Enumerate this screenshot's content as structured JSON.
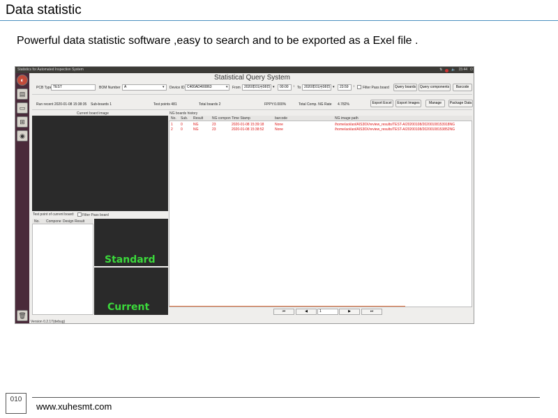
{
  "slide": {
    "title": "Data statistic",
    "subtitle": "Powerful data statistic software ,easy to search and to be exported as a Exel file .",
    "page_number": "010",
    "website": "www.xuhesmt.com"
  },
  "window": {
    "title": "Statistics for Automated Inspection System",
    "tray_time": "15:44",
    "app_title": "Statistical Query System"
  },
  "query": {
    "pcb_type_label": "PCB Type",
    "pcb_type_value": "TEST",
    "bom_number_label": "BOM Number",
    "bom_number_value": "A",
    "device_id_label": "Device ID",
    "device_id_value": "C400AD400863",
    "from_label": "From",
    "from_date": "2020年01月08日",
    "from_time": "00:00",
    "to_label": "To",
    "to_date": "2020年01月08日",
    "to_time": "23:59",
    "filter_pass_label": "Filter Pass board",
    "query_boards_label": "Query boards",
    "query_components_label": "Query components",
    "barcode_label": "Barcode"
  },
  "summary": {
    "run_recent": "Run recent 2020-01-08 15:38:35",
    "sub_boards": "Sub-boards 1",
    "test_points": "Test points 481",
    "total_boards": "Total boards 2",
    "fppy": "FPPY:0.000%",
    "total_comp_ng": "Total Comp. NG Rate",
    "ng_rate": "4.782%",
    "export_excel": "Export Excel",
    "export_images": "Export Images",
    "manage": "Manage",
    "package_data": "Package Data"
  },
  "left_panel": {
    "current_board_image": "Current board image",
    "test_point_label": "Test point of current board:",
    "filter_pass_board": "Filter Pass board",
    "columns": [
      "No.",
      "Compone",
      "Design",
      "Result"
    ],
    "standard_label": "Standard",
    "current_label": "Current"
  },
  "history": {
    "label": "NG boards history",
    "columns": [
      "No.",
      "Sub.",
      "Result",
      "NG compon",
      "Time Stamp",
      "barcode",
      "NG image path"
    ],
    "rows": [
      [
        "1",
        "0",
        "NG",
        "23",
        "2020-01-08 15:39:18",
        "None",
        "/home/aoi/aoi/AIS30X/review_results/TEST-A/20200108/20200108153918NG"
      ],
      [
        "2",
        "0",
        "NG",
        "23",
        "2020-01-08 15:38:52",
        "None",
        "/home/aoi/aoi/AIS30X/review_results/TEST-A/20200108/20200108153852NG"
      ]
    ],
    "page_value": "1"
  },
  "status_bar": {
    "version": "Version 0.2.17(debug)"
  },
  "colors": {
    "ng_text": "#d11111",
    "label_green": "#3bd93b",
    "launcher": "#4a2a3a",
    "rule_blue": "#4a8fbf"
  }
}
